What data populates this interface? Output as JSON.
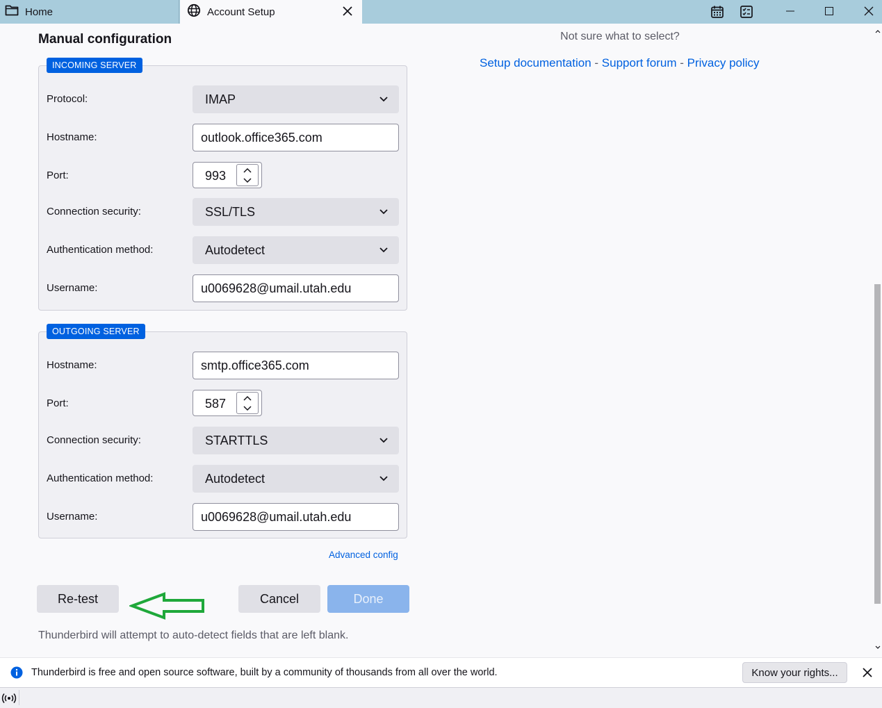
{
  "tabs": [
    {
      "label": "Home",
      "icon": "folder-icon"
    },
    {
      "label": "Account Setup",
      "icon": "globe-icon"
    }
  ],
  "toolbar_icons": [
    "calendar-icon",
    "tasks-icon"
  ],
  "window_controls": [
    "minimize",
    "maximize",
    "close"
  ],
  "section_title": "Manual configuration",
  "incoming": {
    "legend": "INCOMING SERVER",
    "protocol_label": "Protocol:",
    "protocol_value": "IMAP",
    "hostname_label": "Hostname:",
    "hostname_value": "outlook.office365.com",
    "port_label": "Port:",
    "port_value": "993",
    "security_label": "Connection security:",
    "security_value": "SSL/TLS",
    "auth_label": "Authentication method:",
    "auth_value": "Autodetect",
    "username_label": "Username:",
    "username_value": "u0069628@umail.utah.edu"
  },
  "outgoing": {
    "legend": "OUTGOING SERVER",
    "hostname_label": "Hostname:",
    "hostname_value": "smtp.office365.com",
    "port_label": "Port:",
    "port_value": "587",
    "security_label": "Connection security:",
    "security_value": "STARTTLS",
    "auth_label": "Authentication method:",
    "auth_value": "Autodetect",
    "username_label": "Username:",
    "username_value": "u0069628@umail.utah.edu"
  },
  "advanced_config": "Advanced config",
  "buttons": {
    "retest": "Re-test",
    "cancel": "Cancel",
    "done": "Done"
  },
  "hint": "Thunderbird will attempt to auto-detect fields that are left blank.",
  "help": {
    "question": "Not sure what to select?",
    "setup_doc": "Setup documentation",
    "support_forum": "Support forum",
    "privacy_policy": "Privacy policy",
    "separator": " - "
  },
  "notification": {
    "text": "Thunderbird is free and open source software, built by a community of thousands from all over the world.",
    "button": "Know your rights..."
  },
  "colors": {
    "accent": "#0061e0",
    "annotation_arrow": "#1fa83a",
    "titlebar": "#a8ccdc"
  }
}
